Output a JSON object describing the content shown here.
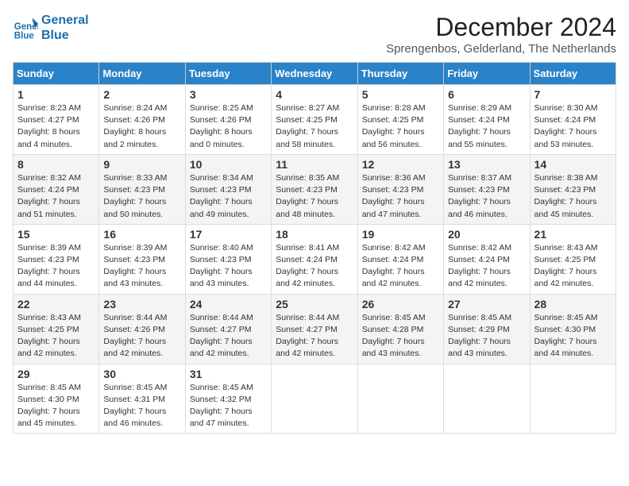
{
  "header": {
    "logo_line1": "General",
    "logo_line2": "Blue",
    "main_title": "December 2024",
    "subtitle": "Sprengenbos, Gelderland, The Netherlands"
  },
  "days_of_week": [
    "Sunday",
    "Monday",
    "Tuesday",
    "Wednesday",
    "Thursday",
    "Friday",
    "Saturday"
  ],
  "weeks": [
    [
      {
        "day": "1",
        "info": "Sunrise: 8:23 AM\nSunset: 4:27 PM\nDaylight: 8 hours\nand 4 minutes."
      },
      {
        "day": "2",
        "info": "Sunrise: 8:24 AM\nSunset: 4:26 PM\nDaylight: 8 hours\nand 2 minutes."
      },
      {
        "day": "3",
        "info": "Sunrise: 8:25 AM\nSunset: 4:26 PM\nDaylight: 8 hours\nand 0 minutes."
      },
      {
        "day": "4",
        "info": "Sunrise: 8:27 AM\nSunset: 4:25 PM\nDaylight: 7 hours\nand 58 minutes."
      },
      {
        "day": "5",
        "info": "Sunrise: 8:28 AM\nSunset: 4:25 PM\nDaylight: 7 hours\nand 56 minutes."
      },
      {
        "day": "6",
        "info": "Sunrise: 8:29 AM\nSunset: 4:24 PM\nDaylight: 7 hours\nand 55 minutes."
      },
      {
        "day": "7",
        "info": "Sunrise: 8:30 AM\nSunset: 4:24 PM\nDaylight: 7 hours\nand 53 minutes."
      }
    ],
    [
      {
        "day": "8",
        "info": "Sunrise: 8:32 AM\nSunset: 4:24 PM\nDaylight: 7 hours\nand 51 minutes."
      },
      {
        "day": "9",
        "info": "Sunrise: 8:33 AM\nSunset: 4:23 PM\nDaylight: 7 hours\nand 50 minutes."
      },
      {
        "day": "10",
        "info": "Sunrise: 8:34 AM\nSunset: 4:23 PM\nDaylight: 7 hours\nand 49 minutes."
      },
      {
        "day": "11",
        "info": "Sunrise: 8:35 AM\nSunset: 4:23 PM\nDaylight: 7 hours\nand 48 minutes."
      },
      {
        "day": "12",
        "info": "Sunrise: 8:36 AM\nSunset: 4:23 PM\nDaylight: 7 hours\nand 47 minutes."
      },
      {
        "day": "13",
        "info": "Sunrise: 8:37 AM\nSunset: 4:23 PM\nDaylight: 7 hours\nand 46 minutes."
      },
      {
        "day": "14",
        "info": "Sunrise: 8:38 AM\nSunset: 4:23 PM\nDaylight: 7 hours\nand 45 minutes."
      }
    ],
    [
      {
        "day": "15",
        "info": "Sunrise: 8:39 AM\nSunset: 4:23 PM\nDaylight: 7 hours\nand 44 minutes."
      },
      {
        "day": "16",
        "info": "Sunrise: 8:39 AM\nSunset: 4:23 PM\nDaylight: 7 hours\nand 43 minutes."
      },
      {
        "day": "17",
        "info": "Sunrise: 8:40 AM\nSunset: 4:23 PM\nDaylight: 7 hours\nand 43 minutes."
      },
      {
        "day": "18",
        "info": "Sunrise: 8:41 AM\nSunset: 4:24 PM\nDaylight: 7 hours\nand 42 minutes."
      },
      {
        "day": "19",
        "info": "Sunrise: 8:42 AM\nSunset: 4:24 PM\nDaylight: 7 hours\nand 42 minutes."
      },
      {
        "day": "20",
        "info": "Sunrise: 8:42 AM\nSunset: 4:24 PM\nDaylight: 7 hours\nand 42 minutes."
      },
      {
        "day": "21",
        "info": "Sunrise: 8:43 AM\nSunset: 4:25 PM\nDaylight: 7 hours\nand 42 minutes."
      }
    ],
    [
      {
        "day": "22",
        "info": "Sunrise: 8:43 AM\nSunset: 4:25 PM\nDaylight: 7 hours\nand 42 minutes."
      },
      {
        "day": "23",
        "info": "Sunrise: 8:44 AM\nSunset: 4:26 PM\nDaylight: 7 hours\nand 42 minutes."
      },
      {
        "day": "24",
        "info": "Sunrise: 8:44 AM\nSunset: 4:27 PM\nDaylight: 7 hours\nand 42 minutes."
      },
      {
        "day": "25",
        "info": "Sunrise: 8:44 AM\nSunset: 4:27 PM\nDaylight: 7 hours\nand 42 minutes."
      },
      {
        "day": "26",
        "info": "Sunrise: 8:45 AM\nSunset: 4:28 PM\nDaylight: 7 hours\nand 43 minutes."
      },
      {
        "day": "27",
        "info": "Sunrise: 8:45 AM\nSunset: 4:29 PM\nDaylight: 7 hours\nand 43 minutes."
      },
      {
        "day": "28",
        "info": "Sunrise: 8:45 AM\nSunset: 4:30 PM\nDaylight: 7 hours\nand 44 minutes."
      }
    ],
    [
      {
        "day": "29",
        "info": "Sunrise: 8:45 AM\nSunset: 4:30 PM\nDaylight: 7 hours\nand 45 minutes."
      },
      {
        "day": "30",
        "info": "Sunrise: 8:45 AM\nSunset: 4:31 PM\nDaylight: 7 hours\nand 46 minutes."
      },
      {
        "day": "31",
        "info": "Sunrise: 8:45 AM\nSunset: 4:32 PM\nDaylight: 7 hours\nand 47 minutes."
      },
      null,
      null,
      null,
      null
    ]
  ]
}
